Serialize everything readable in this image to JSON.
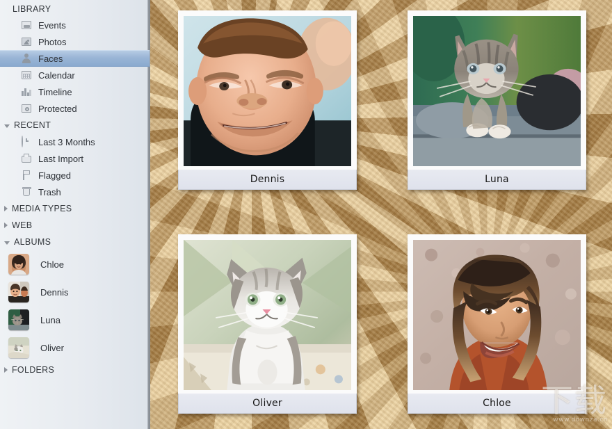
{
  "sidebar": {
    "groups": [
      {
        "id": "library",
        "label": "LIBRARY",
        "expanded": true,
        "items": [
          {
            "label": "Events",
            "icon": "events-icon",
            "selected": false
          },
          {
            "label": "Photos",
            "icon": "photos-icon",
            "selected": false
          },
          {
            "label": "Faces",
            "icon": "faces-icon",
            "selected": true
          },
          {
            "label": "Calendar",
            "icon": "calendar-icon",
            "selected": false
          },
          {
            "label": "Timeline",
            "icon": "timeline-icon",
            "selected": false
          },
          {
            "label": "Protected",
            "icon": "protected-icon",
            "selected": false
          }
        ]
      },
      {
        "id": "recent",
        "label": "RECENT",
        "expanded": true,
        "items": [
          {
            "label": "Last 3 Months",
            "icon": "clock-icon",
            "selected": false
          },
          {
            "label": "Last Import",
            "icon": "import-icon",
            "selected": false
          },
          {
            "label": "Flagged",
            "icon": "flag-icon",
            "selected": false
          },
          {
            "label": "Trash",
            "icon": "trash-icon",
            "selected": false
          }
        ]
      },
      {
        "id": "media-types",
        "label": "MEDIA TYPES",
        "expanded": false,
        "items": []
      },
      {
        "id": "web",
        "label": "WEB",
        "expanded": false,
        "items": []
      },
      {
        "id": "albums",
        "label": "ALBUMS",
        "expanded": true,
        "albums": [
          {
            "label": "Chloe",
            "thumb": "chloe-thumb"
          },
          {
            "label": "Dennis",
            "thumb": "dennis-thumb"
          },
          {
            "label": "Luna",
            "thumb": "luna-thumb"
          },
          {
            "label": "Oliver",
            "thumb": "oliver-thumb"
          }
        ]
      },
      {
        "id": "folders",
        "label": "FOLDERS",
        "expanded": false,
        "items": []
      }
    ]
  },
  "board": {
    "cards": [
      {
        "caption": "Dennis",
        "photo": "boy-squinting-face"
      },
      {
        "caption": "Luna",
        "photo": "grey-tabby-kitten-outdoors"
      },
      {
        "caption": "Oliver",
        "photo": "grey-white-fluffy-kitten"
      },
      {
        "caption": "Chloe",
        "photo": "smiling-woman-portrait"
      }
    ],
    "watermark": {
      "text": "下载",
      "sub": "www.downza.cn"
    }
  },
  "colors": {
    "selection": "#9ab5d6",
    "sidebar_bg": "#e7ebf0",
    "cork": "#c49c5f",
    "caption_bg": "#e3e6ef",
    "card_frame": "#fbfbfb"
  }
}
